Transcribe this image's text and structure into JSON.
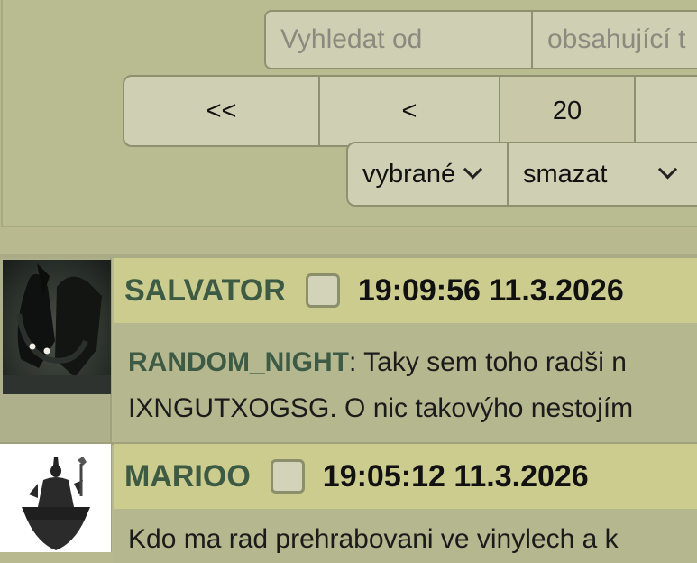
{
  "filter": {
    "search_from_placeholder": "Vyhledat od",
    "search_containing_placeholder": "obsahující t",
    "pager": {
      "first_label": "<<",
      "prev_label": "<",
      "count": "20"
    },
    "selection_label": "vybrané",
    "action_label": "smazat"
  },
  "posts": [
    {
      "author": "SALVATOR",
      "timestamp": "19:09:56 11.3.2026",
      "reply_to": "RANDOM_NIGHT",
      "text_line1": ": Taky sem toho radši n",
      "text_line2": "IXNGUTXOGSG. O nic takovýho nestojím"
    },
    {
      "author": "MARIOO",
      "timestamp": "19:05:12 11.3.2026",
      "text_line1": "Kdo ma rad prehrabovani ve vinylech a k"
    }
  ]
}
